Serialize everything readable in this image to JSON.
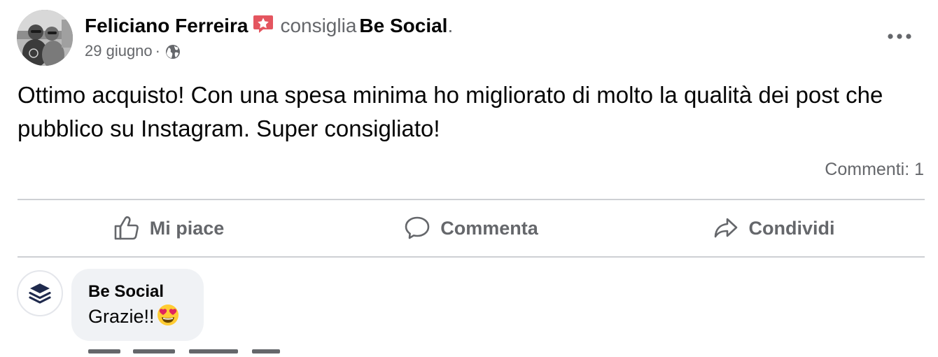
{
  "post": {
    "author_name": "Feliciano Ferreira",
    "recommend_verb": "consiglia",
    "page_name": "Be Social",
    "period": ".",
    "date": "29 giugno",
    "separator": "·",
    "audience_icon": "globe-icon",
    "recommend_icon": "recommendation-star-icon",
    "more_icon": "more-options-icon",
    "text": "Ottimo acquisto! Con una spesa minima ho migliorato di molto la qualità dei post che pubblico su Instagram. Super consigliato!",
    "comment_count": "Commenti: 1"
  },
  "actions": [
    {
      "label": "Mi piace",
      "icon": "thumbs-up-icon"
    },
    {
      "label": "Commenta",
      "icon": "comment-icon"
    },
    {
      "label": "Condividi",
      "icon": "share-arrow-icon"
    }
  ],
  "comment": {
    "author": "Be Social",
    "text": "Grazie!!",
    "emoji_icon": "heart-eyes-emoji-icon",
    "avatar_icon": "layers-logo-icon"
  },
  "colors": {
    "text_primary": "#050505",
    "text_secondary": "#65676b",
    "divider": "#ced0d4",
    "bubble_bg": "#f0f2f5",
    "recommend_red": "#e4555f",
    "logo_navy": "#1f2a4d"
  }
}
